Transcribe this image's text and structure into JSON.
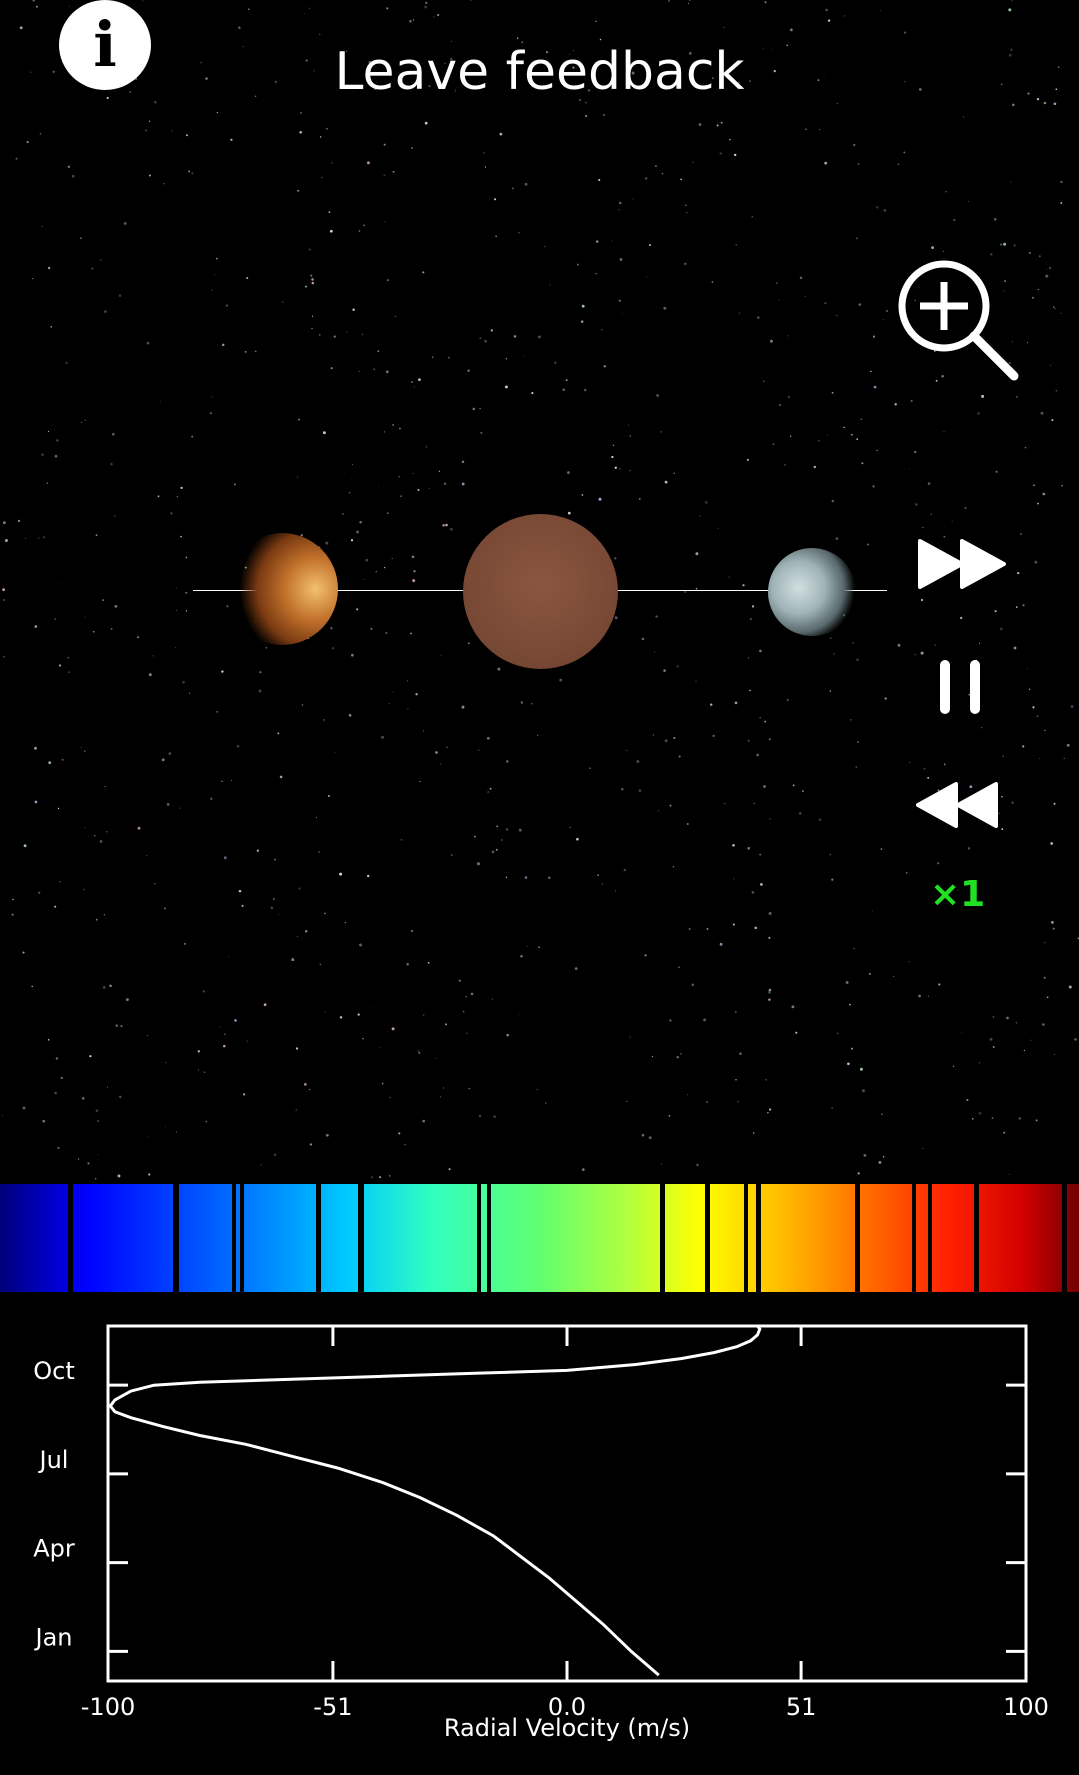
{
  "header": {
    "info_icon": "info-icon",
    "info_glyph": "i",
    "feedback_label": "Leave feedback"
  },
  "controls": {
    "zoom_icon": "zoom-in-icon",
    "fast_forward_icon": "fast-forward-icon",
    "pause_icon": "pause-icon",
    "rewind_icon": "rewind-icon",
    "speed_label": "×1"
  },
  "colors": {
    "speed": "#22e022",
    "background": "#000000",
    "star_planet": "#7a4a36",
    "curve": "#ffffff"
  },
  "chart_data": {
    "type": "line",
    "xlabel": "Radial Velocity (m/s)",
    "x_ticks": [
      "-100",
      "-51",
      "0.0",
      "51",
      "100"
    ],
    "x_tick_values": [
      -100,
      -51,
      0,
      51,
      100
    ],
    "xlim": [
      -100,
      100
    ],
    "y_ticks": [
      "Jan",
      "Apr",
      "Jul",
      "Oct"
    ],
    "y_tick_values": [
      1,
      4,
      7,
      10
    ],
    "ylim": [
      0,
      12
    ],
    "series": [
      {
        "x": [
          20,
          14,
          8,
          2,
          -4,
          -10,
          -16,
          -24,
          -32,
          -40,
          -50,
          -60,
          -70,
          -80,
          -88,
          -95,
          -98.5,
          -99.5,
          -98.5,
          -95,
          -90,
          -80,
          -60,
          -40,
          -20,
          0,
          15,
          25,
          32,
          37,
          40,
          41.5,
          42,
          41.5
        ],
        "y": [
          0.2,
          1.0,
          1.9,
          2.7,
          3.5,
          4.2,
          4.9,
          5.6,
          6.2,
          6.7,
          7.2,
          7.6,
          8.0,
          8.3,
          8.6,
          8.9,
          9.1,
          9.3,
          9.5,
          9.8,
          10.0,
          10.1,
          10.2,
          10.3,
          10.4,
          10.5,
          10.7,
          10.9,
          11.1,
          11.3,
          11.5,
          11.7,
          11.9,
          12.0
        ]
      }
    ]
  }
}
